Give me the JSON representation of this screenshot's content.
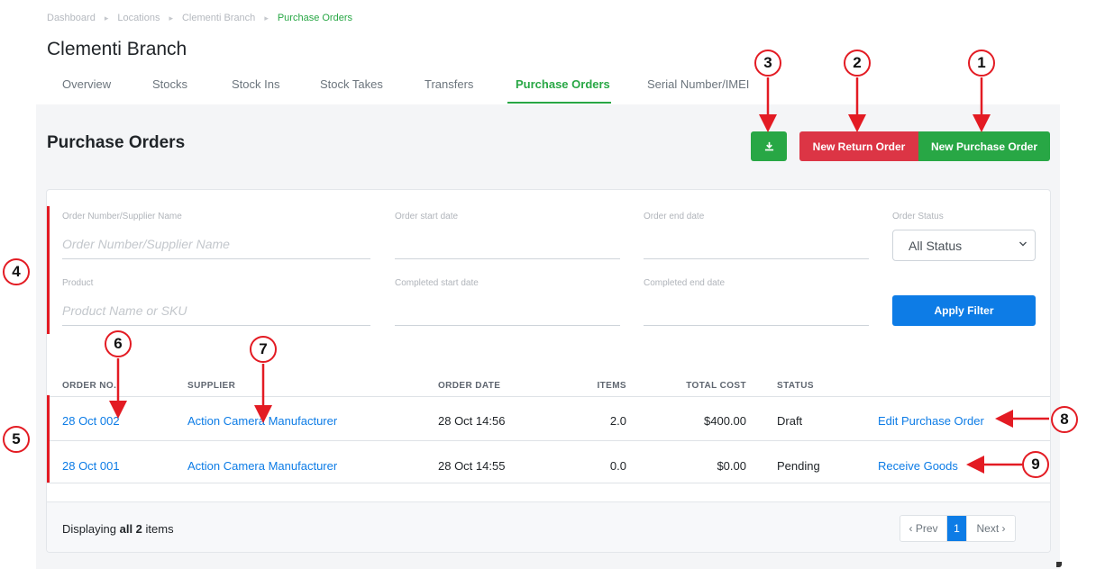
{
  "breadcrumb": {
    "items": [
      "Dashboard",
      "Locations",
      "Clementi Branch"
    ],
    "current": "Purchase Orders",
    "separator": "▸"
  },
  "branch_title": "Clementi Branch",
  "tabs": [
    {
      "label": "Overview",
      "active": false
    },
    {
      "label": "Stocks",
      "active": false
    },
    {
      "label": "Stock Ins",
      "active": false
    },
    {
      "label": "Stock Takes",
      "active": false
    },
    {
      "label": "Transfers",
      "active": false
    },
    {
      "label": "Purchase Orders",
      "active": true
    },
    {
      "label": "Serial Number/IMEI",
      "active": false
    }
  ],
  "page_title": "Purchase Orders",
  "actions": {
    "download_icon": "download-icon",
    "new_return_order": "New Return Order",
    "new_purchase_order": "New Purchase Order"
  },
  "filters": {
    "order_number": {
      "label": "Order Number/Supplier Name",
      "placeholder": "Order Number/Supplier Name",
      "value": ""
    },
    "order_start": {
      "label": "Order start date",
      "value": ""
    },
    "order_end": {
      "label": "Order end date",
      "value": ""
    },
    "order_status": {
      "label": "Order Status",
      "selected": "All Status"
    },
    "product": {
      "label": "Product",
      "placeholder": "Product Name or SKU",
      "value": ""
    },
    "completed_start": {
      "label": "Completed start date",
      "value": ""
    },
    "completed_end": {
      "label": "Completed end date",
      "value": ""
    },
    "apply_label": "Apply Filter"
  },
  "table": {
    "headers": [
      "ORDER NO.",
      "SUPPLIER",
      "ORDER DATE",
      "ITEMS",
      "TOTAL COST",
      "STATUS"
    ],
    "rows": [
      {
        "order_no": "28 Oct 002",
        "supplier": "Action Camera Manufacturer",
        "order_date": "28 Oct 14:56",
        "items": "2.0",
        "total_cost": "$400.00",
        "status": "Draft",
        "action": "Edit Purchase Order"
      },
      {
        "order_no": "28 Oct 001",
        "supplier": "Action Camera Manufacturer",
        "order_date": "28 Oct 14:55",
        "items": "0.0",
        "total_cost": "$0.00",
        "status": "Pending",
        "action": "Receive Goods"
      }
    ]
  },
  "footer": {
    "prefix": "Displaying",
    "count": "all 2",
    "suffix": "items",
    "prev": "‹ Prev",
    "current_page": "1",
    "next": "Next ›"
  },
  "annotations": {
    "color": "#e31b23",
    "labels": [
      "1",
      "2",
      "3",
      "4",
      "5",
      "6",
      "7",
      "8",
      "9"
    ]
  },
  "colors": {
    "brand_green": "#28a745",
    "danger_red": "#dc3545",
    "link_blue": "#0d7ce6"
  }
}
